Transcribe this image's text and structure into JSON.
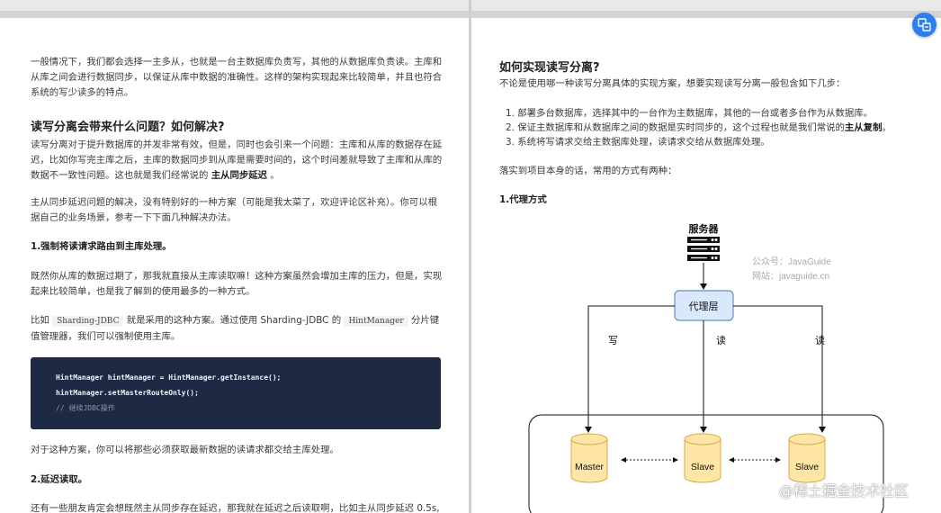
{
  "left": {
    "intro": "一般情况下，我们都会选择一主多从，也就是一台主数据库负责写，其他的从数据库负责读。主库和从库之间会进行数据同步，以保证从库中数据的准确性。这样的架构实现起来比较简单，并且也符合系统的写少读多的特点。",
    "heading": "读写分离会带来什么问题？如何解决?",
    "para1_a": "读写分离对于提升数据库的并发非常有效，但是，同时也会引来一个问题：主库和从库的数据存在延迟，比如你写完主库之后，主库的数据同步到从库是需要时间的，这个时间差就导致了主库和从库的数据不一致性问题。这也就是我们经常说的",
    "para1_b": "主从同步延迟",
    "para1_c": "。",
    "para2": "主从同步延迟问题的解决，没有特别好的一种方案（可能是我太菜了，欢迎评论区补充）。你可以根据自己的业务场景，参考一下下面几种解决办法。",
    "sub1": "1.强制将读请求路由到主库处理。",
    "para3": "既然你从库的数据过期了，那我就直接从主库读取嘛！这种方案虽然会增加主库的压力，但是，实现起来比较简单，也是我了解到的使用最多的一种方式。",
    "para4_a": "比如",
    "para4_code1": "Sharding-JDBC",
    "para4_b": "就是采用的这种方案。通过使用 Sharding-JDBC 的",
    "para4_code2": "HintManager",
    "para4_c": "分片键值管理器，我们可以强制使用主库。",
    "code": [
      "HintManager hintManager = HintManager.getInstance();",
      "hintManager.setMasterRouteOnly();",
      "// 继续JDBC操作"
    ],
    "para5": "对于这种方案，你可以将那些必须获取最新数据的读请求都交给主库处理。",
    "sub2": "2.延迟读取。",
    "para6": "还有一些朋友肯定会想既然主从同步存在延迟，那我就在延迟之后读取啊，比如主从同步延迟 0.5s,"
  },
  "right": {
    "heading": "如何实现读写分离?",
    "para1": "不论是使用哪一种读写分离具体的实现方案，想要实现读写分离一般包含如下几步：",
    "list": [
      {
        "num": "1.",
        "text": "部署多台数据库，选择其中的一台作为主数据库，其他的一台或者多台作为从数据库。",
        "bold": ""
      },
      {
        "num": "2.",
        "text": "保证主数据库和从数据库之间的数据是实时同步的，这个过程也就是我们常说的",
        "bold": "主从复制"
      },
      {
        "num": "3.",
        "text": "系统将写请求交给主数据库处理，读请求交给从数据库处理。",
        "bold": ""
      }
    ],
    "list2_end": "。",
    "para2": "落实到项目本身的话，常用的方式有两种：",
    "sub1": "1.代理方式",
    "diagram": {
      "server_label": "服务器",
      "watermark1": "公众号：JavaGuide",
      "watermark2": "网站：javaguide.cn",
      "proxy_label": "代理层",
      "edge_write": "写",
      "edge_read1": "读",
      "edge_read2": "读",
      "db_master": "Master",
      "db_slave1": "Slave",
      "db_slave2": "Slave"
    }
  },
  "overlay": {
    "watermark": "@稀土掘金技术社区",
    "fab_icon": "translate-icon"
  },
  "colors": {
    "code_bg": "#1e2a44",
    "proxy_fill": "#dae8fc",
    "proxy_stroke": "#6c8ebf",
    "db_fill": "#ffe6a7",
    "db_stroke": "#d6a940",
    "fab": "#2a7ff2"
  }
}
